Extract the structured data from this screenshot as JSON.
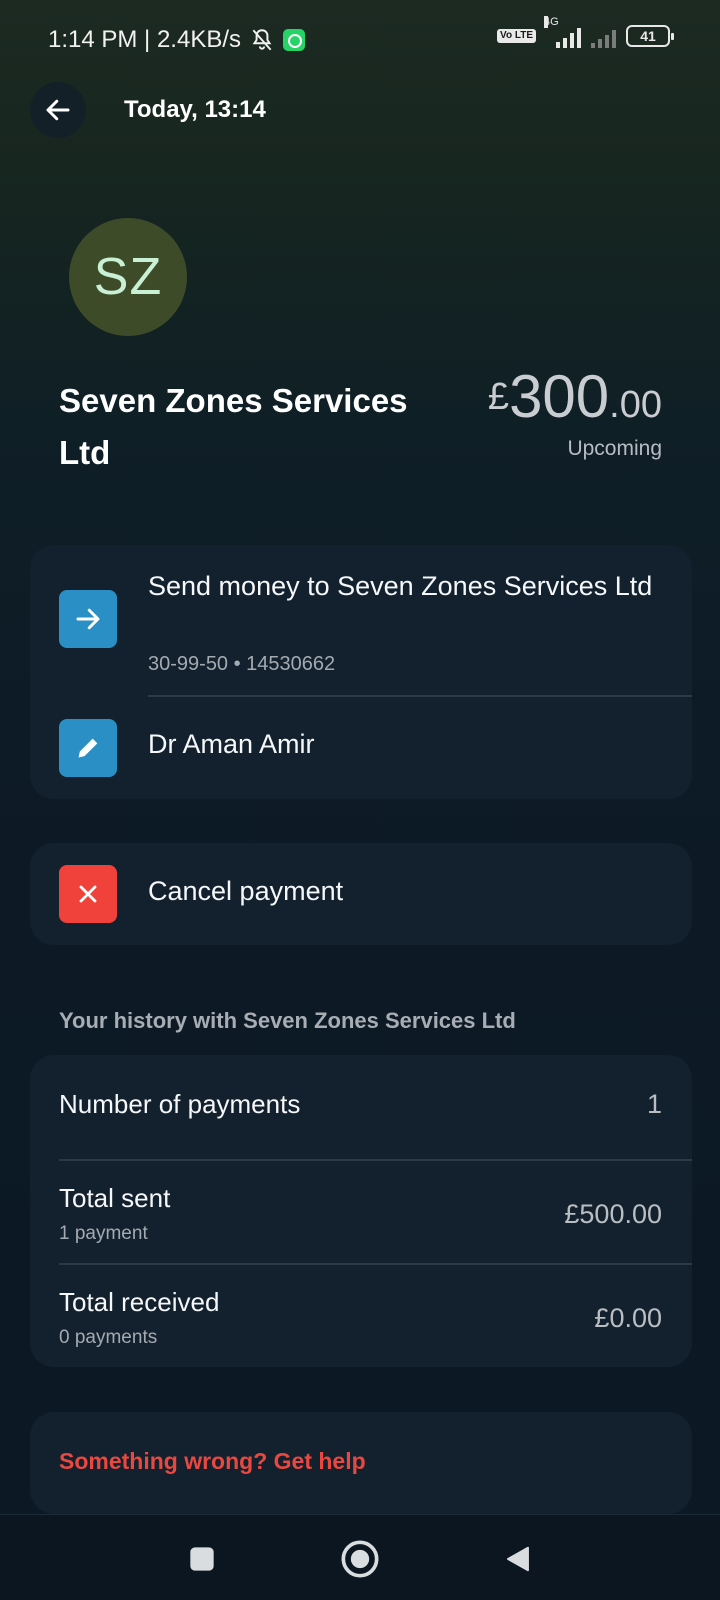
{
  "status_bar": {
    "time_speed": "1:14 PM | 2.4KB/s",
    "volte": "Vo LTE",
    "network": "4G",
    "battery": "41"
  },
  "header": {
    "title": "Today, 13:14"
  },
  "merchant": {
    "initials": "SZ",
    "name": "Seven Zones Services Ltd",
    "amount_currency": "£",
    "amount_whole": "300",
    "amount_decimal": ".00",
    "status": "Upcoming"
  },
  "payment": {
    "title": "Send money to Seven Zones Services Ltd",
    "account": "30-99-50 • 14530662",
    "reference": "Dr Aman Amir"
  },
  "actions": {
    "cancel_label": "Cancel payment"
  },
  "history": {
    "title": "Your history with Seven Zones Services Ltd",
    "rows": [
      {
        "label": "Number of payments",
        "sub": "",
        "value": "1"
      },
      {
        "label": "Total sent",
        "sub": "1 payment",
        "value": "£500.00"
      },
      {
        "label": "Total received",
        "sub": "0 payments",
        "value": "£0.00"
      }
    ]
  },
  "help": {
    "label": "Something wrong? Get help"
  },
  "colors": {
    "accent_blue": "#2a8fc4",
    "danger_red": "#f0423a",
    "help_red": "#e8483f",
    "card_bg": "#13212e"
  },
  "icons": {
    "back": "arrow-left-icon",
    "send": "arrow-right-icon",
    "edit": "pencil-icon",
    "cancel": "close-icon",
    "nav_recents": "square-icon",
    "nav_home": "circle-icon",
    "nav_back": "triangle-back-icon"
  }
}
